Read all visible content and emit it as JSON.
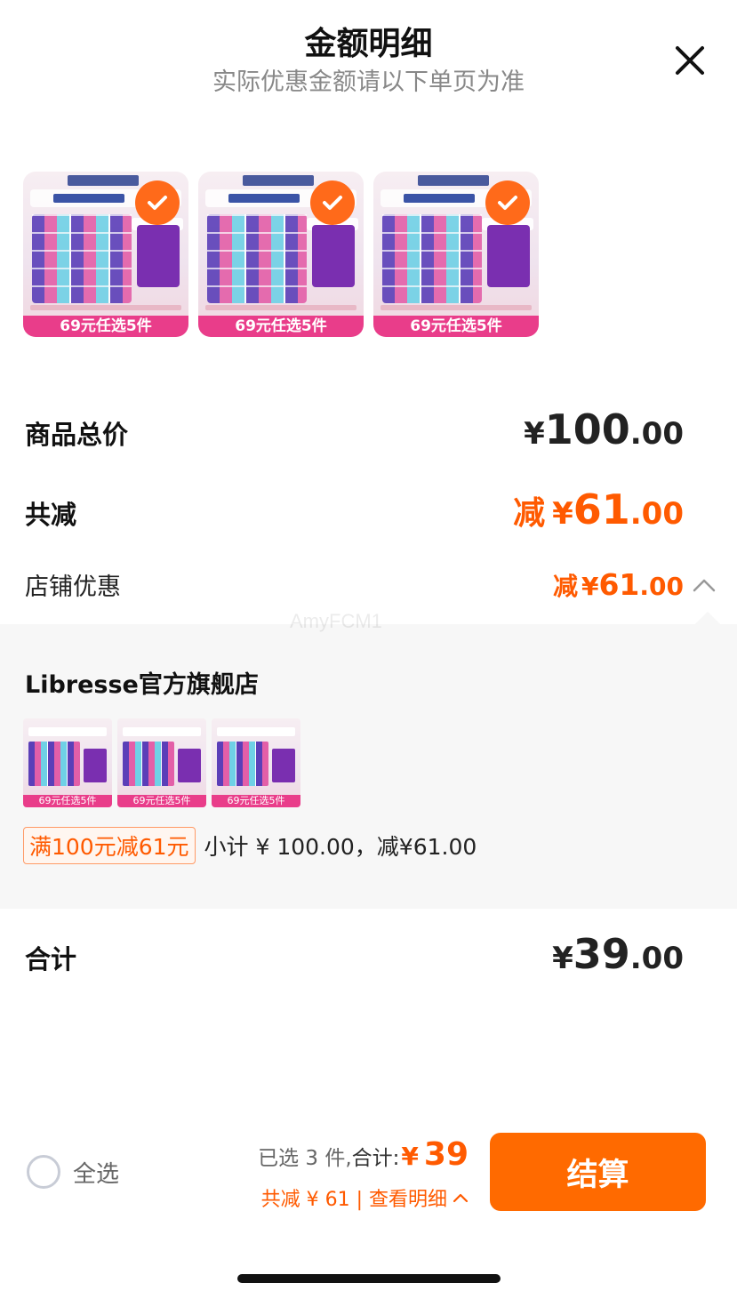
{
  "header": {
    "title": "金额明细",
    "subtitle": "实际优惠金额请以下单页为准",
    "close_icon": "close-icon"
  },
  "products": [
    {
      "banner": "69元任选5件",
      "selected": true
    },
    {
      "banner": "69元任选5件",
      "selected": true
    },
    {
      "banner": "69元任选5件",
      "selected": true
    }
  ],
  "summary": {
    "total_label": "商品总价",
    "total_cur": "¥",
    "total_int": "100",
    "total_dec": ".00",
    "discount_label": "共减",
    "discount_prefix": "减",
    "discount_cur": "¥",
    "discount_int": "61",
    "discount_dec": ".00",
    "store_discount_label": "店铺优惠",
    "store_discount_prefix": "减",
    "store_discount_cur": "¥",
    "store_discount_int": "61",
    "store_discount_dec": ".00",
    "final_label": "合计",
    "final_cur": "¥",
    "final_int": "39",
    "final_dec": ".00"
  },
  "store": {
    "name": "Libresse官方旗舰店",
    "items": [
      {
        "banner": "69元任选5件"
      },
      {
        "banner": "69元任选5件"
      },
      {
        "banner": "69元任选5件"
      }
    ],
    "promo_chip": "满100元减61元",
    "subtotal_text": "小计 ¥ 100.00，减¥61.00"
  },
  "watermark": "AmyFCM1",
  "bottom_bar": {
    "select_all": "全选",
    "selected_desc": "已选 3 件,",
    "total_label": "合计:",
    "total_cur": "¥",
    "total_value": "39",
    "discount_detail": "共减 ¥ 61 | 查看明细",
    "checkout": "结算"
  },
  "colors": {
    "accent": "#ff6a00",
    "discount_text": "#ff5a00",
    "banner_pink": "#e93d8a"
  }
}
